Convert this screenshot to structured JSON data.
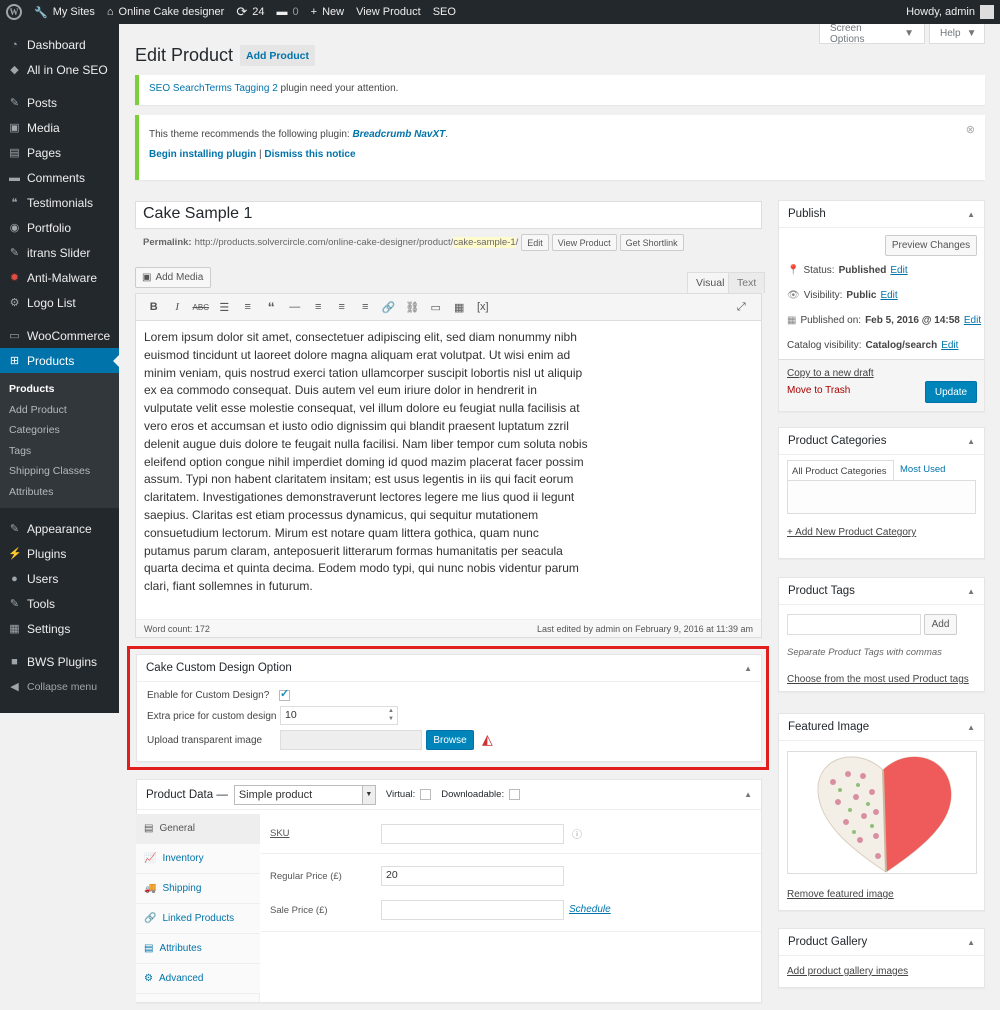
{
  "adminbar": {
    "my_sites": "My Sites",
    "site_name": "Online Cake designer",
    "updates": "24",
    "comments": "0",
    "new": "New",
    "view_product": "View Product",
    "seo": "SEO",
    "howdy": "Howdy, admin"
  },
  "sidebar": {
    "items": [
      {
        "label": "Dashboard",
        "icon": "gauge-icon"
      },
      {
        "label": "All in One SEO",
        "icon": "seo-icon"
      },
      {
        "label": "Posts",
        "icon": "pin-icon"
      },
      {
        "label": "Media",
        "icon": "media-icon"
      },
      {
        "label": "Pages",
        "icon": "pages-icon"
      },
      {
        "label": "Comments",
        "icon": "comment-icon"
      },
      {
        "label": "Testimonials",
        "icon": "quote-icon"
      },
      {
        "label": "Portfolio",
        "icon": "portfolio-icon"
      },
      {
        "label": "itrans Slider",
        "icon": "pin-icon"
      },
      {
        "label": "Anti-Malware",
        "icon": "shield-icon"
      },
      {
        "label": "Logo List",
        "icon": "gear-icon"
      },
      {
        "label": "WooCommerce",
        "icon": "woo-icon"
      },
      {
        "label": "Products",
        "icon": "cart-icon"
      },
      {
        "label": "Appearance",
        "icon": "brush-icon"
      },
      {
        "label": "Plugins",
        "icon": "plug-icon"
      },
      {
        "label": "Users",
        "icon": "user-icon"
      },
      {
        "label": "Tools",
        "icon": "wrench-icon"
      },
      {
        "label": "Settings",
        "icon": "settings-icon"
      },
      {
        "label": "BWS Plugins",
        "icon": "bws-icon"
      }
    ],
    "submenu": [
      "Products",
      "Add Product",
      "Categories",
      "Tags",
      "Shipping Classes",
      "Attributes"
    ],
    "collapse": "Collapse menu"
  },
  "header": {
    "title": "Edit Product",
    "add_button": "Add Product",
    "screen_options": "Screen Options",
    "help": "Help"
  },
  "notices": {
    "seo_link": "SEO SearchTerms Tagging 2",
    "seo_text": " plugin need your attention.",
    "theme_text": "This theme recommends the following plugin: ",
    "theme_plugin": "Breadcrumb NavXT",
    "theme_end": ".",
    "begin_install": "Begin installing plugin",
    "separator": "|",
    "dismiss": "Dismiss this notice"
  },
  "post": {
    "title": "Cake Sample 1",
    "permalink_label": "Permalink:",
    "permalink_base": "http://products.solvercircle.com/online-cake-designer/product/",
    "permalink_slug": "cake-sample-1",
    "permalink_end": "/",
    "edit_btn": "Edit",
    "view_btn": "View Product",
    "shortlink_btn": "Get Shortlink"
  },
  "editor": {
    "add_media": "Add Media",
    "tab_visual": "Visual",
    "tab_text": "Text",
    "content": "Lorem ipsum dolor sit amet, consectetuer adipiscing elit, sed diam nonummy nibh euismod tincidunt ut laoreet dolore magna aliquam erat volutpat. Ut wisi enim ad minim veniam, quis nostrud exerci tation ullamcorper suscipit lobortis nisl ut aliquip ex ea commodo consequat. Duis autem vel eum iriure dolor in hendrerit in vulputate velit esse molestie consequat, vel illum dolore eu feugiat nulla facilisis at vero eros et accumsan et iusto odio dignissim qui blandit praesent luptatum zzril delenit augue duis dolore te feugait nulla facilisi. Nam liber tempor cum soluta nobis eleifend option congue nihil imperdiet doming id quod mazim placerat facer possim assum. Typi non habent claritatem insitam; est usus legentis in iis qui facit eorum claritatem. Investigationes demonstraverunt lectores legere me lius quod ii legunt saepius. Claritas est etiam processus dynamicus, qui sequitur mutationem consuetudium lectorum. Mirum est notare quam littera gothica, quam nunc putamus parum claram, anteposuerit litterarum formas humanitatis per seacula quarta decima et quinta decima. Eodem modo typi, qui nunc nobis videntur parum clari, fiant sollemnes in futurum.",
    "word_count": "Word count: 172",
    "last_edited": "Last edited by admin on February 9, 2016 at 11:39 am"
  },
  "custom_design": {
    "title": "Cake Custom Design Option",
    "enable_label": "Enable for Custom Design?",
    "enable_checked": true,
    "extra_price_label": "Extra price for custom design",
    "extra_price_value": "10",
    "upload_label": "Upload transparent image",
    "browse": "Browse"
  },
  "product_data": {
    "title": "Product Data —",
    "type_value": "Simple product",
    "virtual_label": "Virtual:",
    "downloadable_label": "Downloadable:",
    "tabs": [
      "General",
      "Inventory",
      "Shipping",
      "Linked Products",
      "Attributes",
      "Advanced"
    ],
    "sku_label": "SKU",
    "regular_price_label": "Regular Price (£)",
    "regular_price_value": "20",
    "sale_price_label": "Sale Price (£)",
    "schedule": "Schedule"
  },
  "publish": {
    "title": "Publish",
    "preview": "Preview Changes",
    "status_label": "Status:",
    "status_value": "Published",
    "visibility_label": "Visibility:",
    "visibility_value": "Public",
    "published_label": "Published on:",
    "published_value": "Feb 5, 2016 @ 14:58",
    "catalog_label": "Catalog visibility:",
    "catalog_value": "Catalog/search",
    "edit": "Edit",
    "copy_draft": "Copy to a new draft",
    "trash": "Move to Trash",
    "update": "Update"
  },
  "categories": {
    "title": "Product Categories",
    "tab_all": "All Product Categories",
    "tab_most": "Most Used",
    "add_new": "+ Add New Product Category"
  },
  "tags": {
    "title": "Product Tags",
    "add": "Add",
    "hint": "Separate Product Tags with commas",
    "choose": "Choose from the most used Product tags"
  },
  "featured": {
    "title": "Featured Image",
    "remove": "Remove featured image"
  },
  "gallery": {
    "title": "Product Gallery",
    "add": "Add product gallery images"
  },
  "colors": {
    "accent": "#0073aa",
    "sidebar": "#23282d",
    "highlight_border": "#e21d1d",
    "notice_green": "#7ad03a"
  }
}
